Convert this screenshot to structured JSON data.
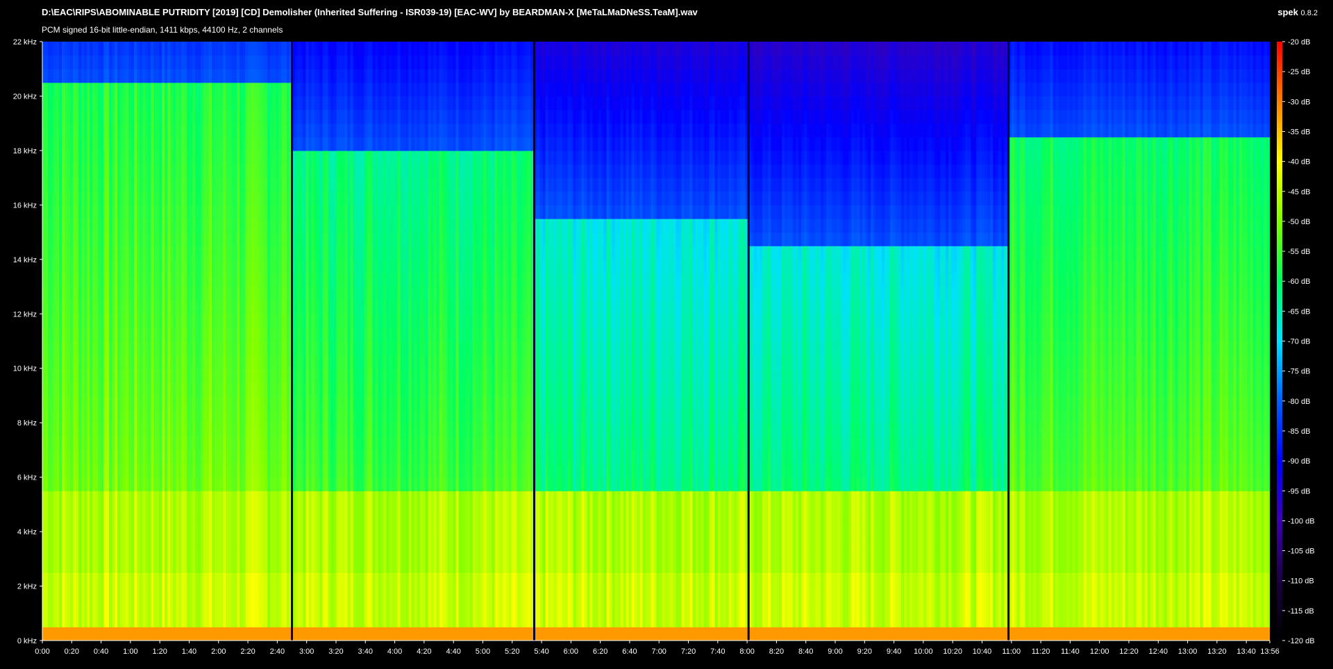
{
  "header": {
    "file_title": "D:\\EAC\\RIPS\\ABOMINABLE PUTRIDITY [2019] [CD] Demolisher (Inherited Suffering - ISR039-19) [EAC-WV] by BEARDMAN-X [MeTaLMaDNeSS.TeaM].wav",
    "format_info": "PCM signed 16-bit little-endian, 1411 kbps, 44100 Hz, 2 channels",
    "app_name": "spek",
    "app_version": "0.8.2"
  },
  "chart_data": {
    "type": "heatmap",
    "title": "",
    "xlabel": "",
    "ylabel": "",
    "x_range_seconds": [
      0,
      836
    ],
    "x_tick_labels": [
      "0:00",
      "0:20",
      "0:40",
      "1:00",
      "1:20",
      "1:40",
      "2:00",
      "2:20",
      "2:40",
      "3:00",
      "3:20",
      "3:40",
      "4:00",
      "4:20",
      "4:40",
      "5:00",
      "5:20",
      "5:40",
      "6:00",
      "6:20",
      "6:40",
      "7:00",
      "7:20",
      "7:40",
      "8:00",
      "8:20",
      "8:40",
      "9:00",
      "9:20",
      "9:40",
      "10:00",
      "10:20",
      "10:40",
      "11:00",
      "11:20",
      "11:40",
      "12:00",
      "12:20",
      "12:40",
      "13:00",
      "13:20",
      "13:40",
      "13:56"
    ],
    "x_tick_values_seconds": [
      0,
      20,
      40,
      60,
      80,
      100,
      120,
      140,
      160,
      180,
      200,
      220,
      240,
      260,
      280,
      300,
      320,
      340,
      360,
      380,
      400,
      420,
      440,
      460,
      480,
      500,
      520,
      540,
      560,
      580,
      600,
      620,
      640,
      660,
      680,
      700,
      720,
      740,
      760,
      780,
      800,
      820,
      836
    ],
    "y_range_khz": [
      0,
      22
    ],
    "y_tick_labels": [
      "0 kHz",
      "2 kHz",
      "4 kHz",
      "6 kHz",
      "8 kHz",
      "10 kHz",
      "12 kHz",
      "14 kHz",
      "16 kHz",
      "18 kHz",
      "20 kHz",
      "22 kHz"
    ],
    "y_tick_values_khz": [
      0,
      2,
      4,
      6,
      8,
      10,
      12,
      14,
      16,
      18,
      20,
      22
    ],
    "colorbar_range_db": [
      -120,
      -20
    ],
    "colorbar_tick_labels": [
      "-20 dB",
      "-25 dB",
      "-30 dB",
      "-35 dB",
      "-40 dB",
      "-45 dB",
      "-50 dB",
      "-55 dB",
      "-60 dB",
      "-65 dB",
      "-70 dB",
      "-75 dB",
      "-80 dB",
      "-85 dB",
      "-90 dB",
      "-95 dB",
      "-100 dB",
      "-105 dB",
      "-110 dB",
      "-115 dB",
      "-120 dB"
    ],
    "colorbar_tick_values_db": [
      -20,
      -25,
      -30,
      -35,
      -40,
      -45,
      -50,
      -55,
      -60,
      -65,
      -70,
      -75,
      -80,
      -85,
      -90,
      -95,
      -100,
      -105,
      -110,
      -115,
      -120
    ],
    "colormap": [
      "#000000",
      "#1a0040",
      "#3a00b0",
      "#0000ff",
      "#0060ff",
      "#00e0ff",
      "#00ff60",
      "#80ff00",
      "#ffff00",
      "#ff8000",
      "#ff0000"
    ],
    "track_boundaries_seconds": [
      170,
      335,
      481,
      658
    ],
    "segments": [
      {
        "start": 0,
        "end": 170,
        "cutoff_khz": 20.5,
        "level": 0.72
      },
      {
        "start": 170,
        "end": 335,
        "cutoff_khz": 18.0,
        "level": 0.68
      },
      {
        "start": 335,
        "end": 481,
        "cutoff_khz": 15.5,
        "level": 0.62
      },
      {
        "start": 481,
        "end": 658,
        "cutoff_khz": 14.5,
        "level": 0.62
      },
      {
        "start": 658,
        "end": 836,
        "cutoff_khz": 18.5,
        "level": 0.7
      }
    ]
  }
}
